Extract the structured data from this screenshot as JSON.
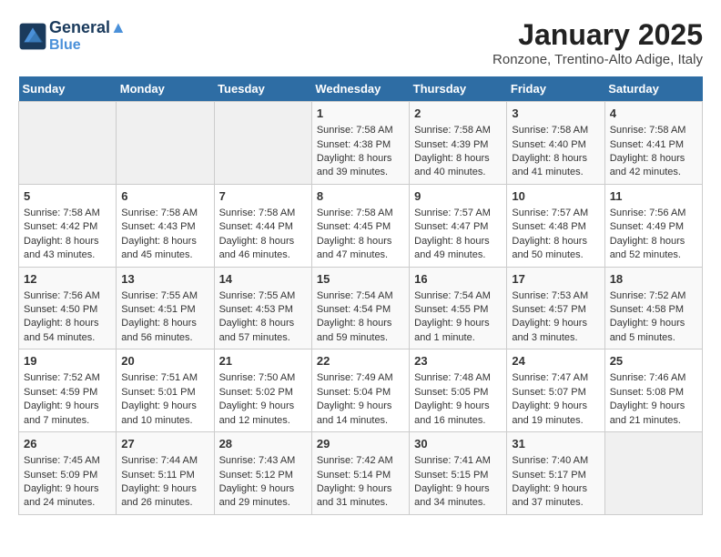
{
  "header": {
    "logo_line1": "General",
    "logo_line2": "Blue",
    "month": "January 2025",
    "location": "Ronzone, Trentino-Alto Adige, Italy"
  },
  "weekdays": [
    "Sunday",
    "Monday",
    "Tuesday",
    "Wednesday",
    "Thursday",
    "Friday",
    "Saturday"
  ],
  "weeks": [
    [
      {
        "day": "",
        "empty": true
      },
      {
        "day": "",
        "empty": true
      },
      {
        "day": "",
        "empty": true
      },
      {
        "day": "1",
        "sunrise": "7:58 AM",
        "sunset": "4:38 PM",
        "daylight": "8 hours and 39 minutes."
      },
      {
        "day": "2",
        "sunrise": "7:58 AM",
        "sunset": "4:39 PM",
        "daylight": "8 hours and 40 minutes."
      },
      {
        "day": "3",
        "sunrise": "7:58 AM",
        "sunset": "4:40 PM",
        "daylight": "8 hours and 41 minutes."
      },
      {
        "day": "4",
        "sunrise": "7:58 AM",
        "sunset": "4:41 PM",
        "daylight": "8 hours and 42 minutes."
      }
    ],
    [
      {
        "day": "5",
        "sunrise": "7:58 AM",
        "sunset": "4:42 PM",
        "daylight": "8 hours and 43 minutes."
      },
      {
        "day": "6",
        "sunrise": "7:58 AM",
        "sunset": "4:43 PM",
        "daylight": "8 hours and 45 minutes."
      },
      {
        "day": "7",
        "sunrise": "7:58 AM",
        "sunset": "4:44 PM",
        "daylight": "8 hours and 46 minutes."
      },
      {
        "day": "8",
        "sunrise": "7:58 AM",
        "sunset": "4:45 PM",
        "daylight": "8 hours and 47 minutes."
      },
      {
        "day": "9",
        "sunrise": "7:57 AM",
        "sunset": "4:47 PM",
        "daylight": "8 hours and 49 minutes."
      },
      {
        "day": "10",
        "sunrise": "7:57 AM",
        "sunset": "4:48 PM",
        "daylight": "8 hours and 50 minutes."
      },
      {
        "day": "11",
        "sunrise": "7:56 AM",
        "sunset": "4:49 PM",
        "daylight": "8 hours and 52 minutes."
      }
    ],
    [
      {
        "day": "12",
        "sunrise": "7:56 AM",
        "sunset": "4:50 PM",
        "daylight": "8 hours and 54 minutes."
      },
      {
        "day": "13",
        "sunrise": "7:55 AM",
        "sunset": "4:51 PM",
        "daylight": "8 hours and 56 minutes."
      },
      {
        "day": "14",
        "sunrise": "7:55 AM",
        "sunset": "4:53 PM",
        "daylight": "8 hours and 57 minutes."
      },
      {
        "day": "15",
        "sunrise": "7:54 AM",
        "sunset": "4:54 PM",
        "daylight": "8 hours and 59 minutes."
      },
      {
        "day": "16",
        "sunrise": "7:54 AM",
        "sunset": "4:55 PM",
        "daylight": "9 hours and 1 minute."
      },
      {
        "day": "17",
        "sunrise": "7:53 AM",
        "sunset": "4:57 PM",
        "daylight": "9 hours and 3 minutes."
      },
      {
        "day": "18",
        "sunrise": "7:52 AM",
        "sunset": "4:58 PM",
        "daylight": "9 hours and 5 minutes."
      }
    ],
    [
      {
        "day": "19",
        "sunrise": "7:52 AM",
        "sunset": "4:59 PM",
        "daylight": "9 hours and 7 minutes."
      },
      {
        "day": "20",
        "sunrise": "7:51 AM",
        "sunset": "5:01 PM",
        "daylight": "9 hours and 10 minutes."
      },
      {
        "day": "21",
        "sunrise": "7:50 AM",
        "sunset": "5:02 PM",
        "daylight": "9 hours and 12 minutes."
      },
      {
        "day": "22",
        "sunrise": "7:49 AM",
        "sunset": "5:04 PM",
        "daylight": "9 hours and 14 minutes."
      },
      {
        "day": "23",
        "sunrise": "7:48 AM",
        "sunset": "5:05 PM",
        "daylight": "9 hours and 16 minutes."
      },
      {
        "day": "24",
        "sunrise": "7:47 AM",
        "sunset": "5:07 PM",
        "daylight": "9 hours and 19 minutes."
      },
      {
        "day": "25",
        "sunrise": "7:46 AM",
        "sunset": "5:08 PM",
        "daylight": "9 hours and 21 minutes."
      }
    ],
    [
      {
        "day": "26",
        "sunrise": "7:45 AM",
        "sunset": "5:09 PM",
        "daylight": "9 hours and 24 minutes."
      },
      {
        "day": "27",
        "sunrise": "7:44 AM",
        "sunset": "5:11 PM",
        "daylight": "9 hours and 26 minutes."
      },
      {
        "day": "28",
        "sunrise": "7:43 AM",
        "sunset": "5:12 PM",
        "daylight": "9 hours and 29 minutes."
      },
      {
        "day": "29",
        "sunrise": "7:42 AM",
        "sunset": "5:14 PM",
        "daylight": "9 hours and 31 minutes."
      },
      {
        "day": "30",
        "sunrise": "7:41 AM",
        "sunset": "5:15 PM",
        "daylight": "9 hours and 34 minutes."
      },
      {
        "day": "31",
        "sunrise": "7:40 AM",
        "sunset": "5:17 PM",
        "daylight": "9 hours and 37 minutes."
      },
      {
        "day": "",
        "empty": true
      }
    ]
  ]
}
